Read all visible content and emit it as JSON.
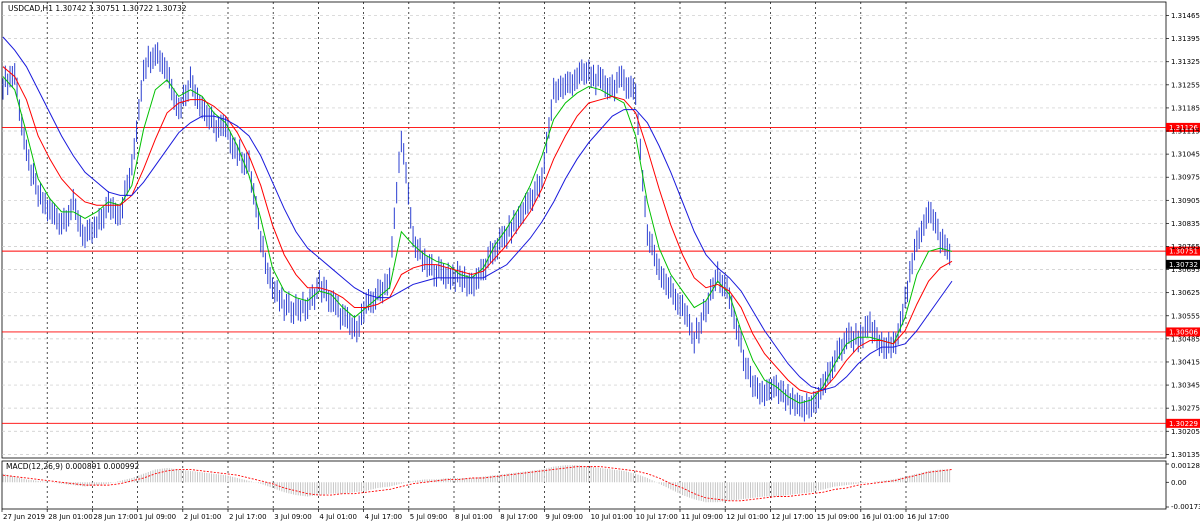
{
  "colors": {
    "background": "#ffffff",
    "grid": "#c8c8c8",
    "vgrid": "#000000",
    "candles": "#2b3fd1",
    "ma_fast": "#00c000",
    "ma_mid": "#ff0000",
    "ma_slow": "#1a1adc",
    "hline": "#ff0000",
    "price_marker": "#ff0000",
    "macd_signal": "#ff0000",
    "macd_hist": "#c0c0c0"
  },
  "chart_data": [
    {
      "type": "line",
      "header": "USDCAD,H1  1.30742 1.30751 1.30722 1.30732",
      "ylim": [
        1.3013,
        1.315
      ],
      "y_ticks": [
        "1.31465",
        "1.31395",
        "1.31325",
        "1.31255",
        "1.31185",
        "1.31115",
        "1.31045",
        "1.30975",
        "1.30905",
        "1.30835",
        "1.30765",
        "1.30695",
        "1.30625",
        "1.30555",
        "1.30485",
        "1.30415",
        "1.30345",
        "1.30275",
        "1.30205",
        "1.30135"
      ],
      "x_tick_labels": [
        "27 Jun 2019",
        "28 Jun 01:00",
        "28 Jun 17:00",
        "1 Jul 09:00",
        "2 Jul 01:00",
        "2 Jul 17:00",
        "3 Jul 09:00",
        "4 Jul 01:00",
        "4 Jul 17:00",
        "5 Jul 09:00",
        "8 Jul 01:00",
        "8 Jul 17:00",
        "9 Jul 09:00",
        "10 Jul 01:00",
        "10 Jul 17:00",
        "11 Jul 09:00",
        "12 Jul 01:00",
        "12 Jul 17:00",
        "15 Jul 09:00",
        "16 Jul 01:00",
        "16 Jul 17:00"
      ],
      "horizontal_levels": [
        {
          "value": 1.31126,
          "label": "1.31126"
        },
        {
          "value": 1.30751,
          "label": "1.30751"
        },
        {
          "value": 1.30506,
          "label": "1.30506"
        },
        {
          "value": 1.30229,
          "label": "1.30229"
        }
      ],
      "current_price": {
        "value": 1.30732,
        "label": "1.30732"
      },
      "series": [
        {
          "key": "price",
          "style": "bars",
          "values": [
            1.3126,
            1.3129,
            1.3104,
            1.3092,
            1.3087,
            1.3084,
            1.3089,
            1.3079,
            1.3082,
            1.3089,
            1.3087,
            1.31,
            1.3131,
            1.3136,
            1.313,
            1.3118,
            1.3127,
            1.3119,
            1.3113,
            1.3112,
            1.3105,
            1.3101,
            1.3079,
            1.3064,
            1.3058,
            1.3058,
            1.3058,
            1.3065,
            1.306,
            1.3055,
            1.3051,
            1.3058,
            1.3062,
            1.3067,
            1.311,
            1.3079,
            1.3071,
            1.3069,
            1.3068,
            1.3067,
            1.3065,
            1.3069,
            1.3076,
            1.308,
            1.3085,
            1.3091,
            1.3096,
            1.3124,
            1.3125,
            1.3128,
            1.3129,
            1.3126,
            1.3125,
            1.3127,
            1.3123,
            1.308,
            1.307,
            1.3063,
            1.3058,
            1.3048,
            1.3058,
            1.3068,
            1.3061,
            1.3046,
            1.3033,
            1.3032,
            1.3033,
            1.303,
            1.3027,
            1.3028,
            1.3034,
            1.3042,
            1.3049,
            1.3049,
            1.3052,
            1.3046,
            1.3046,
            1.306,
            1.3078,
            1.3088,
            1.3079,
            1.3073
          ]
        },
        {
          "key": "ma_fast",
          "style": "line",
          "values": [
            1.3128,
            1.3124,
            1.3111,
            1.3097,
            1.3091,
            1.3087,
            1.3087,
            1.3085,
            1.3087,
            1.309,
            1.3089,
            1.3095,
            1.3112,
            1.3124,
            1.3127,
            1.3122,
            1.3124,
            1.3122,
            1.3117,
            1.3114,
            1.3107,
            1.3098,
            1.3085,
            1.307,
            1.3063,
            1.3061,
            1.306,
            1.3063,
            1.3062,
            1.3058,
            1.3055,
            1.3058,
            1.3061,
            1.3064,
            1.3081,
            1.3077,
            1.3074,
            1.3072,
            1.3071,
            1.3068,
            1.3067,
            1.307,
            1.3077,
            1.3082,
            1.3088,
            1.3095,
            1.3104,
            1.3115,
            1.312,
            1.3123,
            1.3125,
            1.3124,
            1.3122,
            1.312,
            1.311,
            1.309,
            1.3076,
            1.3068,
            1.3063,
            1.3058,
            1.306,
            1.3066,
            1.3062,
            1.3051,
            1.3042,
            1.3036,
            1.3034,
            1.3031,
            1.3029,
            1.303,
            1.3034,
            1.3041,
            1.3047,
            1.3049,
            1.3049,
            1.3048,
            1.3047,
            1.3055,
            1.3068,
            1.3075,
            1.3076,
            1.3075
          ]
        },
        {
          "key": "ma_mid",
          "style": "line",
          "values": [
            1.3131,
            1.3128,
            1.3121,
            1.311,
            1.3103,
            1.3097,
            1.3093,
            1.309,
            1.3089,
            1.3089,
            1.3089,
            1.3092,
            1.31,
            1.3109,
            1.3117,
            1.312,
            1.3121,
            1.3121,
            1.3119,
            1.3116,
            1.3111,
            1.3104,
            1.3095,
            1.3083,
            1.3074,
            1.3068,
            1.3064,
            1.3064,
            1.3063,
            1.3061,
            1.3058,
            1.3058,
            1.3059,
            1.3061,
            1.3068,
            1.307,
            1.3071,
            1.3071,
            1.307,
            1.3069,
            1.3068,
            1.3069,
            1.3073,
            1.3077,
            1.3082,
            1.3087,
            1.3094,
            1.3103,
            1.311,
            1.3116,
            1.312,
            1.3121,
            1.3122,
            1.3121,
            1.3117,
            1.3106,
            1.3094,
            1.3083,
            1.3074,
            1.3067,
            1.3064,
            1.3065,
            1.3063,
            1.3058,
            1.305,
            1.3044,
            1.304,
            1.3036,
            1.3033,
            1.3032,
            1.3033,
            1.3037,
            1.3042,
            1.3046,
            1.3048,
            1.3048,
            1.3047,
            1.3051,
            1.3059,
            1.3066,
            1.307,
            1.3072
          ]
        },
        {
          "key": "ma_slow",
          "style": "line",
          "values": [
            1.314,
            1.3136,
            1.3131,
            1.3124,
            1.3117,
            1.311,
            1.3104,
            1.3099,
            1.3096,
            1.3093,
            1.3092,
            1.3092,
            1.3096,
            1.3101,
            1.3106,
            1.3111,
            1.3114,
            1.3116,
            1.3116,
            1.3115,
            1.3113,
            1.311,
            1.3104,
            1.3096,
            1.3088,
            1.3081,
            1.3076,
            1.3073,
            1.307,
            1.3067,
            1.3064,
            1.3062,
            1.3061,
            1.3061,
            1.3063,
            1.3065,
            1.3066,
            1.3067,
            1.3067,
            1.3067,
            1.3067,
            1.3067,
            1.3069,
            1.3071,
            1.3075,
            1.3079,
            1.3084,
            1.309,
            1.3097,
            1.3103,
            1.3108,
            1.3112,
            1.3116,
            1.3118,
            1.3118,
            1.3114,
            1.3107,
            1.3099,
            1.309,
            1.3081,
            1.3074,
            1.307,
            1.3067,
            1.3063,
            1.3057,
            1.3051,
            1.3046,
            1.3041,
            1.3037,
            1.3034,
            1.3033,
            1.3034,
            1.3037,
            1.3041,
            1.3044,
            1.3046,
            1.3046,
            1.3047,
            1.3051,
            1.3056,
            1.3061,
            1.3066
          ]
        }
      ]
    },
    {
      "type": "bar",
      "header": "MACD(12,26,9) 0.000891 0.000992",
      "ylim": [
        -0.001738,
        0.001284
      ],
      "y_ticks": [
        "0.001284",
        "0.00",
        "-0.001738"
      ],
      "series": [
        {
          "key": "macd_main",
          "style": "bars",
          "values": [
            0.0006,
            0.0004,
            0.0002,
            0.0001,
            0.0,
            -0.0001,
            -0.0002,
            -0.0003,
            -0.0002,
            -0.0001,
            0.0001,
            0.0003,
            0.0006,
            0.0009,
            0.001,
            0.0009,
            0.0008,
            0.0007,
            0.0006,
            0.0005,
            0.0003,
            0.0001,
            -0.0001,
            -0.0004,
            -0.0007,
            -0.0009,
            -0.001,
            -0.0009,
            -0.0008,
            -0.0008,
            -0.0007,
            -0.0006,
            -0.0004,
            -0.0003,
            -0.0001,
            0.0001,
            0.0002,
            0.0002,
            0.0003,
            0.0003,
            0.0003,
            0.0004,
            0.0005,
            0.0006,
            0.0007,
            0.0008,
            0.0009,
            0.0011,
            0.0012,
            0.0012,
            0.0011,
            0.001,
            0.0009,
            0.0008,
            0.0006,
            0.0003,
            -0.0001,
            -0.0005,
            -0.0009,
            -0.0012,
            -0.0014,
            -0.0014,
            -0.0013,
            -0.0012,
            -0.0011,
            -0.001,
            -0.001,
            -0.0009,
            -0.0008,
            -0.0007,
            -0.0005,
            -0.0003,
            -0.0002,
            -0.0001,
            0.0,
            0.0001,
            0.0002,
            0.0004,
            0.0006,
            0.0008,
            0.0009,
            0.0009
          ]
        },
        {
          "key": "macd_signal",
          "style": "line",
          "values": [
            0.0005,
            0.0004,
            0.0003,
            0.0002,
            0.0001,
            0.0,
            -0.0001,
            -0.0002,
            -0.0002,
            -0.0002,
            -0.0001,
            0.0001,
            0.0003,
            0.0006,
            0.0008,
            0.0009,
            0.0009,
            0.0008,
            0.0007,
            0.0006,
            0.0005,
            0.0003,
            0.0001,
            -0.0001,
            -0.0004,
            -0.0006,
            -0.0008,
            -0.0009,
            -0.0009,
            -0.0008,
            -0.0008,
            -0.0007,
            -0.0006,
            -0.0005,
            -0.0003,
            -0.0001,
            0.0,
            0.0001,
            0.0002,
            0.0002,
            0.0003,
            0.0003,
            0.0004,
            0.0005,
            0.0006,
            0.0007,
            0.0008,
            0.0009,
            0.001,
            0.0011,
            0.0011,
            0.0011,
            0.001,
            0.0009,
            0.0008,
            0.0006,
            0.0003,
            -0.0001,
            -0.0004,
            -0.0008,
            -0.0011,
            -0.0012,
            -0.0013,
            -0.0013,
            -0.0012,
            -0.0011,
            -0.001,
            -0.001,
            -0.0009,
            -0.0008,
            -0.0007,
            -0.0005,
            -0.0004,
            -0.0002,
            -0.0001,
            0.0,
            0.0001,
            0.0003,
            0.0005,
            0.0007,
            0.0008,
            0.0009
          ]
        }
      ]
    }
  ]
}
